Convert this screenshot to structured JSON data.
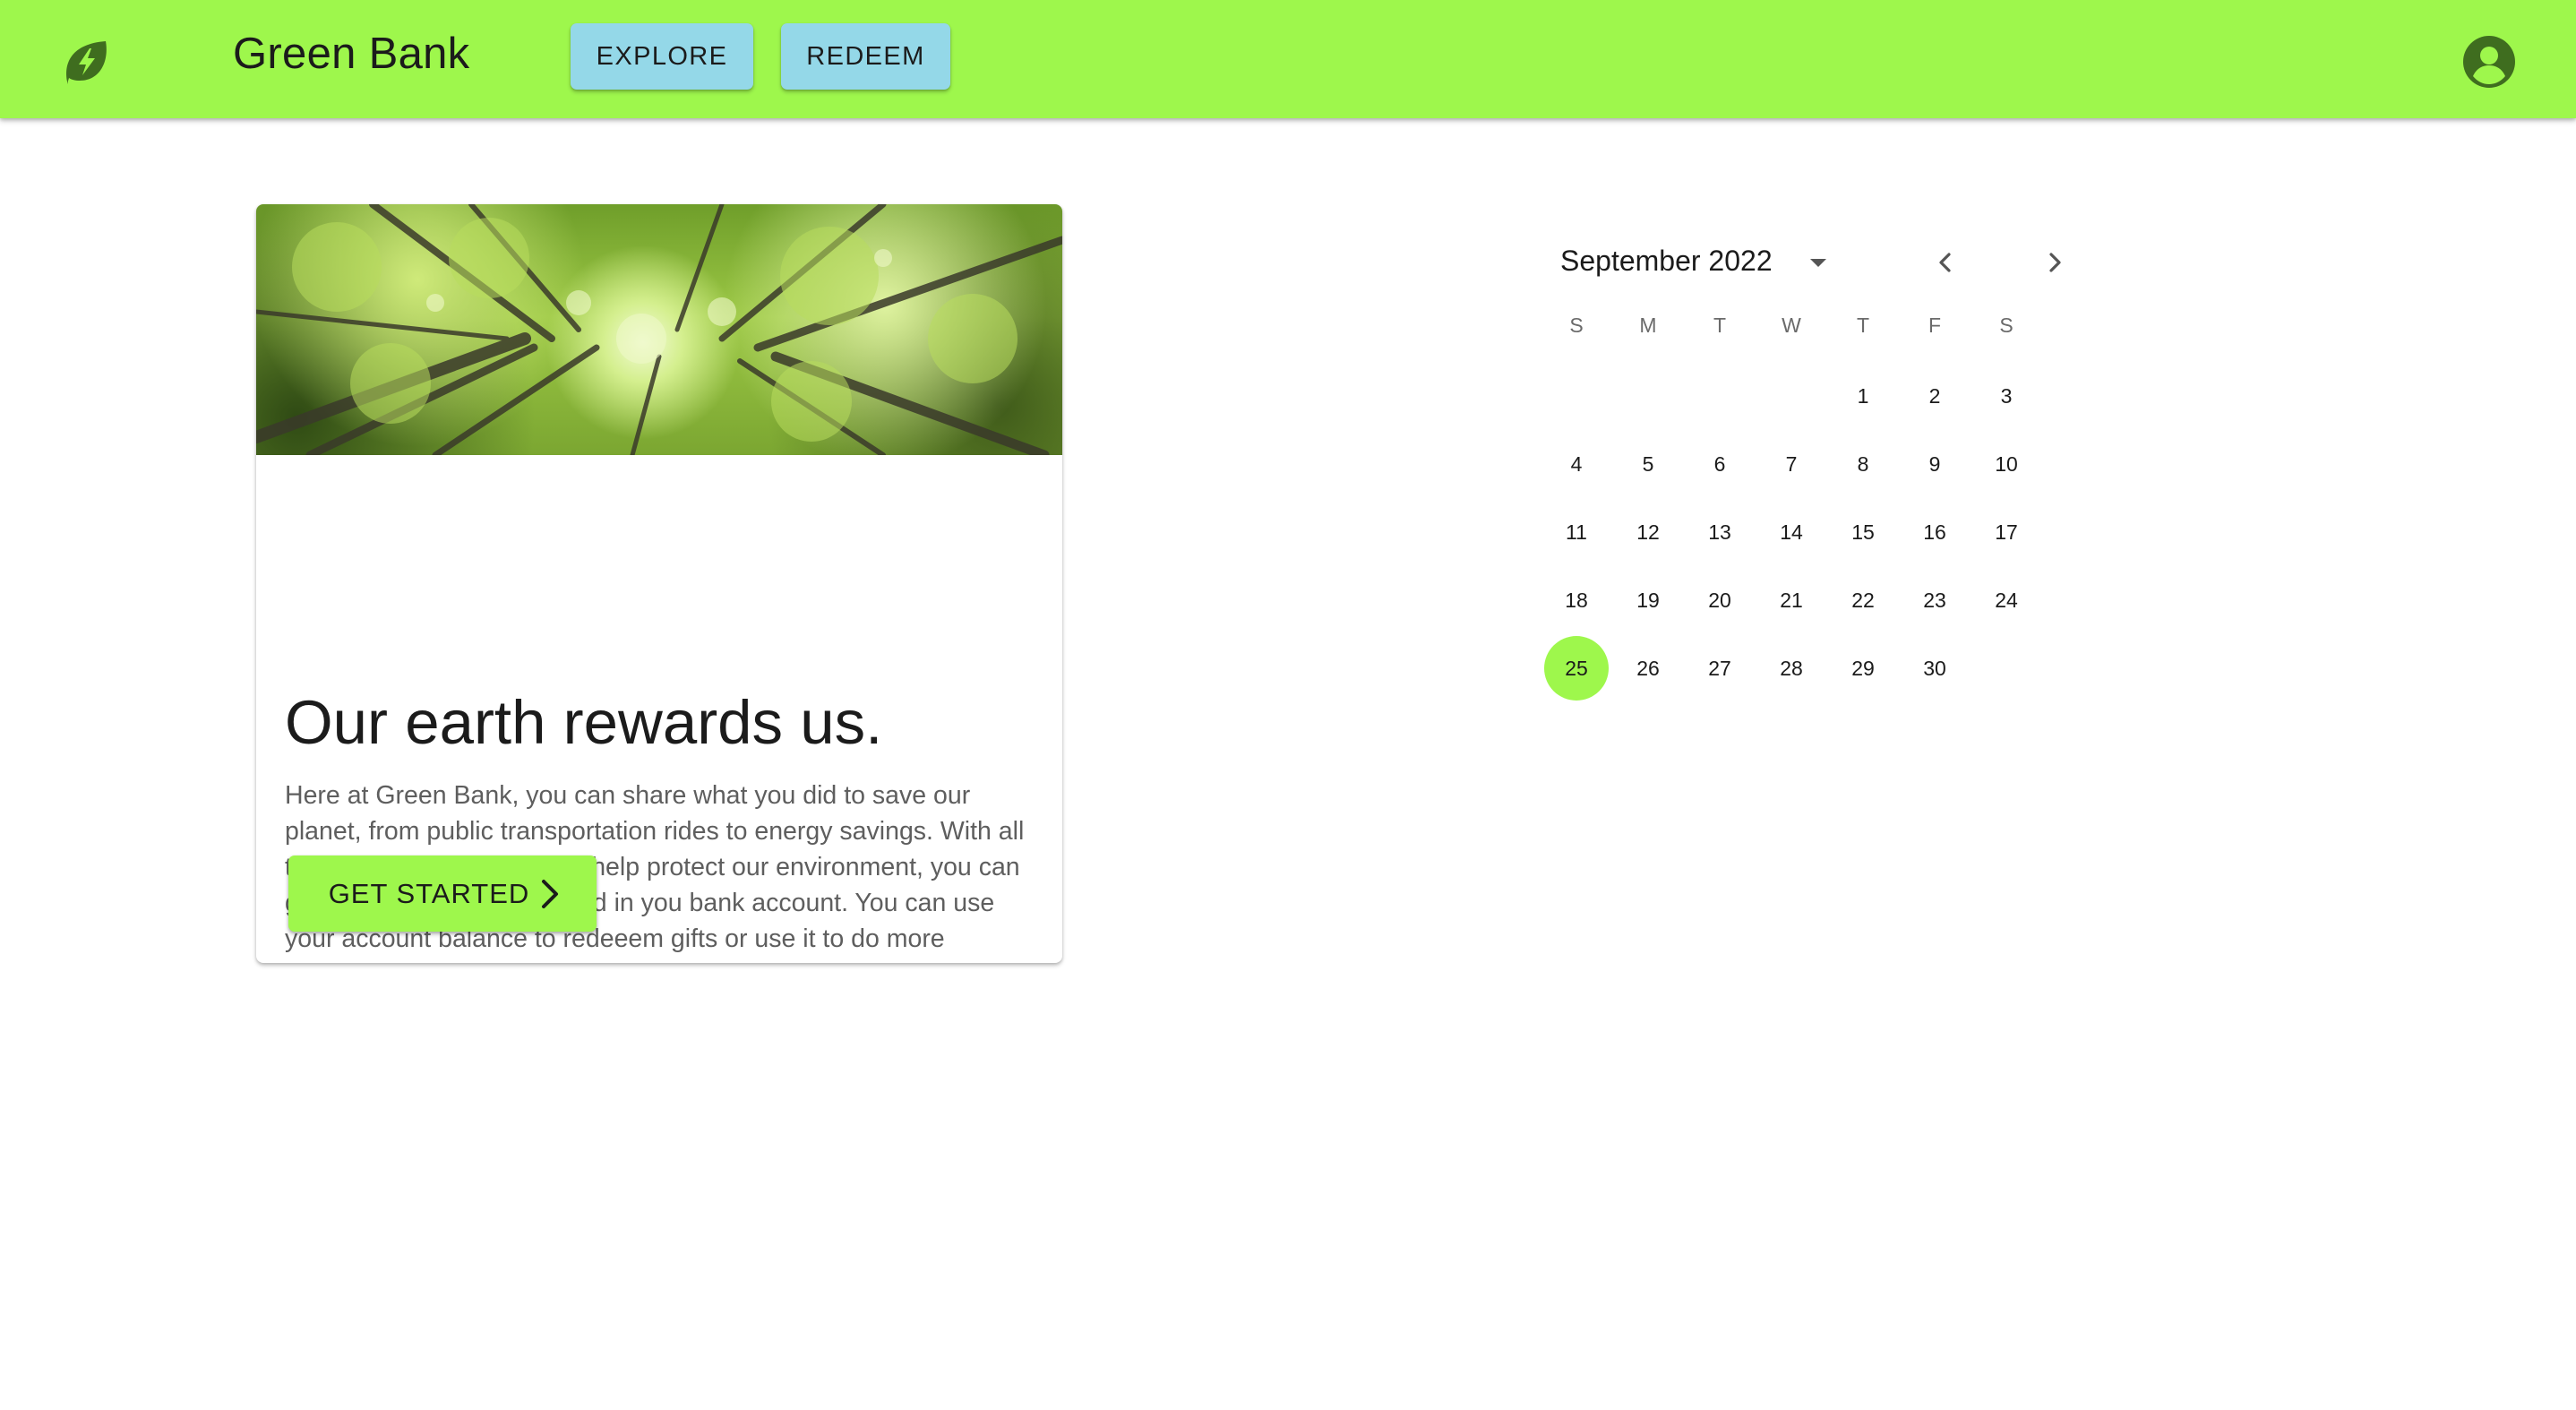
{
  "app": {
    "title": "Green Bank",
    "logo_icon": "leaf-bolt-icon",
    "profile_icon": "account-circle-icon"
  },
  "nav": {
    "explore_label": "EXPLORE",
    "redeem_label": "REDEEM"
  },
  "card": {
    "image_icon": "forest-canopy-image",
    "title": "Our earth rewards us.",
    "body": "Here at Green Bank, you can share what you did to save our planet, from public transportation rides to energy savings. With all the moves that you take to help protect our environment, you can get a point and will be saved in you bank account. You can use your account balance to redeeem gifts or use it to do more meaningful things.",
    "cta_label": "GET STARTED"
  },
  "calendar": {
    "month_label": "September 2022",
    "weekdays": [
      "S",
      "M",
      "T",
      "W",
      "T",
      "F",
      "S"
    ],
    "first_weekday_index": 4,
    "days": [
      "1",
      "2",
      "3",
      "4",
      "5",
      "6",
      "7",
      "8",
      "9",
      "10",
      "11",
      "12",
      "13",
      "14",
      "15",
      "16",
      "17",
      "18",
      "19",
      "20",
      "21",
      "22",
      "23",
      "24",
      "25",
      "26",
      "27",
      "28",
      "29",
      "30"
    ],
    "selected_day": "25"
  },
  "colors": {
    "accent": "#9ef74c",
    "nav_button": "#94d8e8",
    "icon_dark": "#3f6d1f"
  }
}
